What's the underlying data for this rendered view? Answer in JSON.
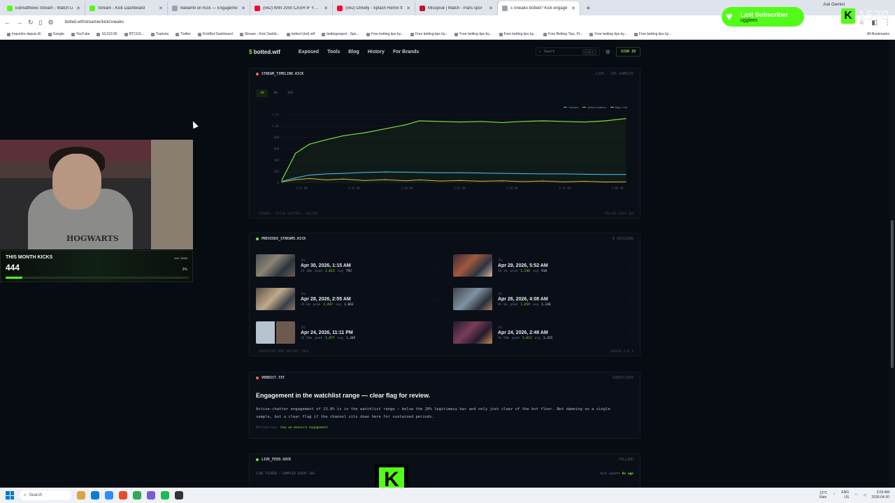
{
  "browser": {
    "tabs": [
      {
        "title": "Edmatthews Stream - Watch Li",
        "color": "#53fc18"
      },
      {
        "title": "Stream - Kick Dashboard",
        "color": "#53fc18"
      },
      {
        "title": "Babamti on Kick — Engageme",
        "color": "#9aa4b2"
      },
      {
        "title": "(562) WIN 2000 CASH IF YOU C",
        "color": "#ff0033"
      },
      {
        "title": "(562) Omelly - Splash Remix ft",
        "color": "#ff0033"
      },
      {
        "title": "Misojoue | Match - Paris spor",
        "color": "#c0122c"
      },
      {
        "title": "s Sneako botted? Kick engage",
        "color": "#9aa4b2",
        "active": true
      }
    ],
    "new_tab": "+",
    "ask_gemini": "Ask Gemini",
    "url": "botted.wtf/streamer/kick/sneako",
    "bookmarks": [
      "Importés depuis IE",
      "Google",
      "YouTube",
      "16,623.96",
      "BTCUS...",
      "Traduire",
      "Twitter",
      "KickBot Dashboard",
      "Stream - Kick Dashb...",
      "botted (dot) wtf",
      "bettingexpert - Spo...",
      "Free betting tips by...",
      "Free betting tips by...",
      "Free betting tips by...",
      "Free betting tips by...",
      "Free Betting Tips, Pr...",
      "Free betting tips by...",
      "Free betting tips by..."
    ],
    "all_bookmarks": "All Bookmarks"
  },
  "site": {
    "logo_symbol": "$",
    "logo_text": "botted.wtf",
    "nav": [
      "Exposed",
      "Tools",
      "Blog",
      "History",
      "For Brands"
    ],
    "search_placeholder": "Search",
    "search_shortcut": "CTRL K",
    "sign_in": "SIGN IN"
  },
  "timeline": {
    "title": "STREAM_TIMELINE.KICK",
    "status": "LIVE · 185 SAMPLES",
    "ranges": [
      "1H",
      "6H",
      "15H"
    ],
    "active_range": "1H",
    "footer_left": "VIEWERS · ACTIVE CHATTERS · MSG/MIN",
    "footer_right": "POLLING EVERY 60S"
  },
  "chart_data": {
    "type": "line",
    "title": "",
    "xlabel": "",
    "ylabel": "",
    "ylim": [
      0,
      1200
    ],
    "yticks": [
      "0",
      "200",
      "400",
      "600",
      "800",
      "1.0k",
      "1.2k"
    ],
    "xticks": [
      "1:15 AM",
      "1:45 AM",
      "2:00 AM",
      "2:15 AM",
      "2:30 AM",
      "2:45 AM",
      "3:00 AM"
    ],
    "x": [
      0,
      0.04,
      0.08,
      0.13,
      0.18,
      0.24,
      0.3,
      0.36,
      0.4,
      0.46,
      0.52,
      0.58,
      0.64,
      0.7,
      0.76,
      0.82,
      0.88,
      0.94,
      1.0
    ],
    "series": [
      {
        "name": "Viewers",
        "color": "#7ee03a",
        "values": [
          50,
          520,
          680,
          760,
          830,
          880,
          950,
          1020,
          1090,
          1080,
          1070,
          1080,
          1060,
          1080,
          1090,
          1080,
          1070,
          1090,
          1130
        ]
      },
      {
        "name": "Active chatters",
        "color": "#4fc3f7",
        "values": [
          30,
          90,
          140,
          160,
          170,
          185,
          195,
          190,
          185,
          180,
          180,
          175,
          170,
          165,
          160,
          160,
          155,
          150,
          150
        ]
      },
      {
        "name": "Msg / min",
        "color": "#e0b23a",
        "values": [
          20,
          60,
          80,
          55,
          70,
          45,
          60,
          40,
          55,
          35,
          45,
          30,
          40,
          25,
          35,
          20,
          30,
          18,
          20
        ]
      }
    ]
  },
  "previous_streams": {
    "title": "PREVIOUS_STREAMS.KICK",
    "count": "6 SESSIONS",
    "items": [
      {
        "category": "IRL",
        "date": "Apr 30, 2026, 1:15 AM",
        "duration": "1h 40m",
        "peak": "1,013",
        "avg": "792"
      },
      {
        "category": "IRL",
        "date": "Apr 29, 2026, 5:52 AM",
        "duration": "3h 3m",
        "peak": "1,546",
        "avg": "910"
      },
      {
        "category": "IRL",
        "date": "Apr 28, 2026, 2:55 AM",
        "duration": "2h 6m",
        "peak": "1,447",
        "avg": "1,063"
      },
      {
        "category": "IRL",
        "date": "Apr 26, 2026, 4:08 AM",
        "duration": "6h 0m",
        "peak": "1,659",
        "avg": "1,146"
      },
      {
        "category": "IRL",
        "date": "Apr 24, 2026, 11:11 PM",
        "duration": "1h 56m",
        "peak": "1,877",
        "avg": "1,305"
      },
      {
        "category": "IRL",
        "date": "Apr 24, 2026, 2:48 AM",
        "duration": "5h 50m",
        "peak": "2,812",
        "avg": "1,435"
      }
    ],
    "footer_left": "AGGREGATED FROM SNAPSHOT TABLE",
    "footer_right": "SHOWING 6 OF 6",
    "peak_label": "peak",
    "avg_label": "avg",
    "arrow": "→"
  },
  "verdict": {
    "title": "VERDICT.TXT",
    "status": "SUSPICIOUS",
    "headline": "Engagement in the watchlist range — clear flag for review.",
    "body": "Active-chatter engagement of 13.8% is in the watchlist range — below the 20% legitimacy bar and only just clear of the bot floor. Not damning on a single sample, but a clear flag if the channel sits down here for sustained periods.",
    "methodology_label": "Methodology:",
    "methodology_link": "how we measure engagement"
  },
  "live_feed": {
    "title": "LIVE_FEED.SOCK",
    "status": "POLLING",
    "ticker": "LIVE TICKER — SAMPLED EVERY 30S",
    "last_update_label": "last update",
    "last_update_value": "0s ago"
  },
  "overlay": {
    "webcam_text": "HOGWARTS",
    "kicks_label": "THIS MONTH KICKS",
    "kicks_count": "444",
    "kicks_goal": "444 / 5000",
    "kicks_pct": "9%",
    "kicks_progress": 0.09,
    "sub_title": "Last Subscriber",
    "sub_name": "ugglees",
    "kick_total": "1570",
    "kick_letter": "K"
  },
  "taskbar": {
    "search": "Search",
    "weather_temp": "12°C",
    "weather_text": "Rain",
    "lang": "ENG",
    "region": "US",
    "time": "3:03 AM",
    "date": "2026-04-30"
  }
}
